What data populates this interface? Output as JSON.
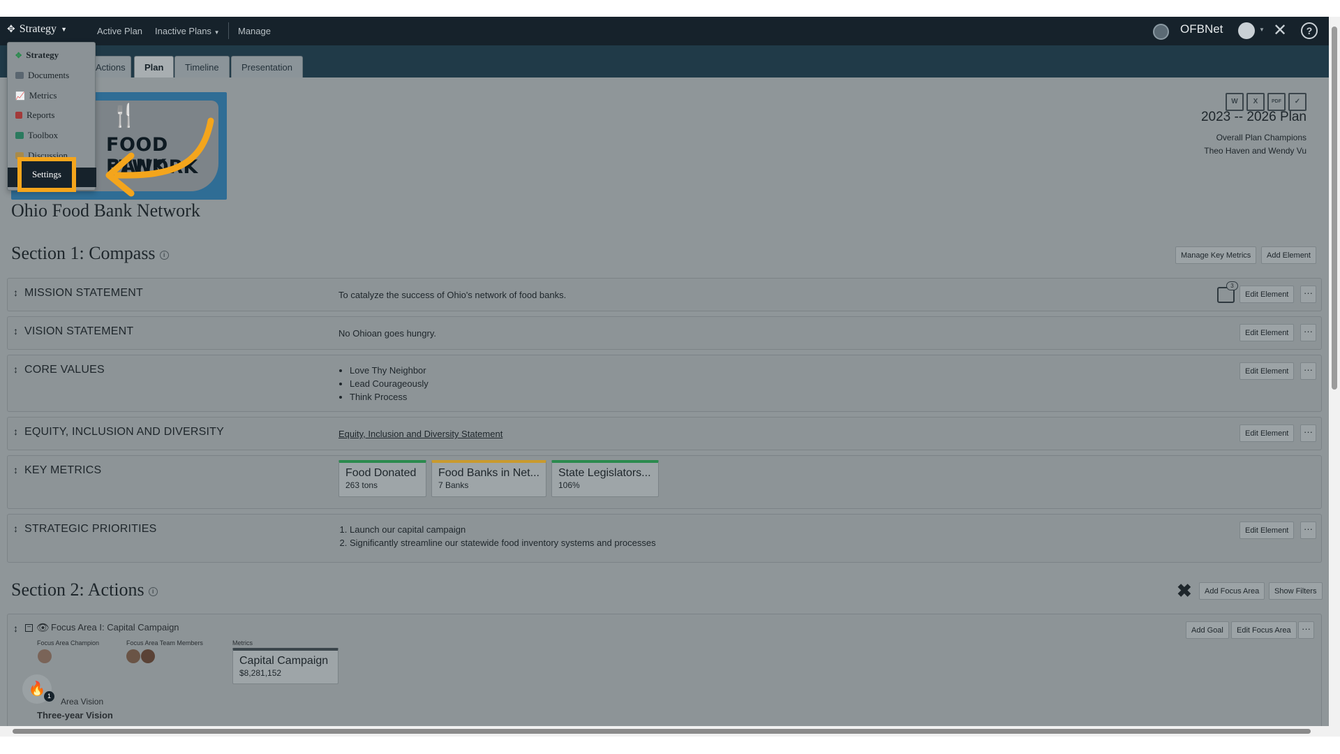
{
  "nav": {
    "brand": "Strategy",
    "links": [
      "Active Plan",
      "Inactive Plans",
      "Manage"
    ],
    "org_name": "OFBNet"
  },
  "tabs": [
    "Actions",
    "Plan",
    "Timeline",
    "Presentation"
  ],
  "active_tab": "Plan",
  "menu": {
    "items": [
      "Strategy",
      "Documents",
      "Metrics",
      "Reports",
      "Toolbox",
      "Discussion"
    ],
    "highlighted": "Settings"
  },
  "logo": {
    "line1": "FOOD BANK",
    "line2": "ETWORK"
  },
  "org_title": "Ohio Food Bank Network",
  "plan": {
    "title": "2023 -- 2026 Plan",
    "champions_label": "Overall Plan Champions",
    "champions": "Theo Haven and Wendy Vu",
    "doc_icons": [
      "W",
      "X",
      "PDF",
      "✓"
    ]
  },
  "section1": {
    "title": "Section 1: Compass",
    "buttons": [
      "Manage Key Metrics",
      "Add Element"
    ],
    "comment_count": "3",
    "edit_label": "Edit Element",
    "more_label": "···",
    "rows": {
      "mission": {
        "label": "MISSION STATEMENT",
        "value": "To catalyze the success of Ohio's network of food banks."
      },
      "vision": {
        "label": "VISION STATEMENT",
        "value": "No Ohioan goes hungry."
      },
      "core": {
        "label": "CORE VALUES",
        "values": [
          "Love Thy Neighbor",
          "Lead Courageously",
          "Think Process"
        ]
      },
      "equity": {
        "label": "EQUITY, INCLUSION AND DIVERSITY",
        "link": "Equity, Inclusion and Diversity Statement"
      },
      "metrics": {
        "label": "KEY METRICS",
        "cards": [
          {
            "title": "Food Donated",
            "value": "263 tons",
            "bar": "#2b8a4e"
          },
          {
            "title": "Food Banks in Net...",
            "value": "7 Banks",
            "bar": "#c99a2e"
          },
          {
            "title": "State Legislators...",
            "value": "106%",
            "bar": "#2b8a4e"
          }
        ]
      },
      "priorities": {
        "label": "STRATEGIC PRIORITIES",
        "values": [
          "Launch our capital campaign",
          "Significantly streamline our statewide food inventory systems and processes"
        ]
      }
    }
  },
  "section2": {
    "title": "Section 2: Actions",
    "buttons": [
      "Add Focus Area",
      "Show Filters"
    ],
    "focus": {
      "title": "Focus Area I: Capital Campaign",
      "champion_label": "Focus Area Champion",
      "team_label": "Focus Area Team Members",
      "metrics_label": "Metrics",
      "metric_title": "Capital Campaign",
      "metric_value": "$8,281,152",
      "vision_label": "Area Vision",
      "vision_title": "Three-year Vision",
      "badge": "1",
      "buttons": [
        "Add Goal",
        "Edit Focus Area"
      ]
    }
  },
  "colors": {
    "accent": "#f4a51c",
    "nav": "#16222b"
  }
}
